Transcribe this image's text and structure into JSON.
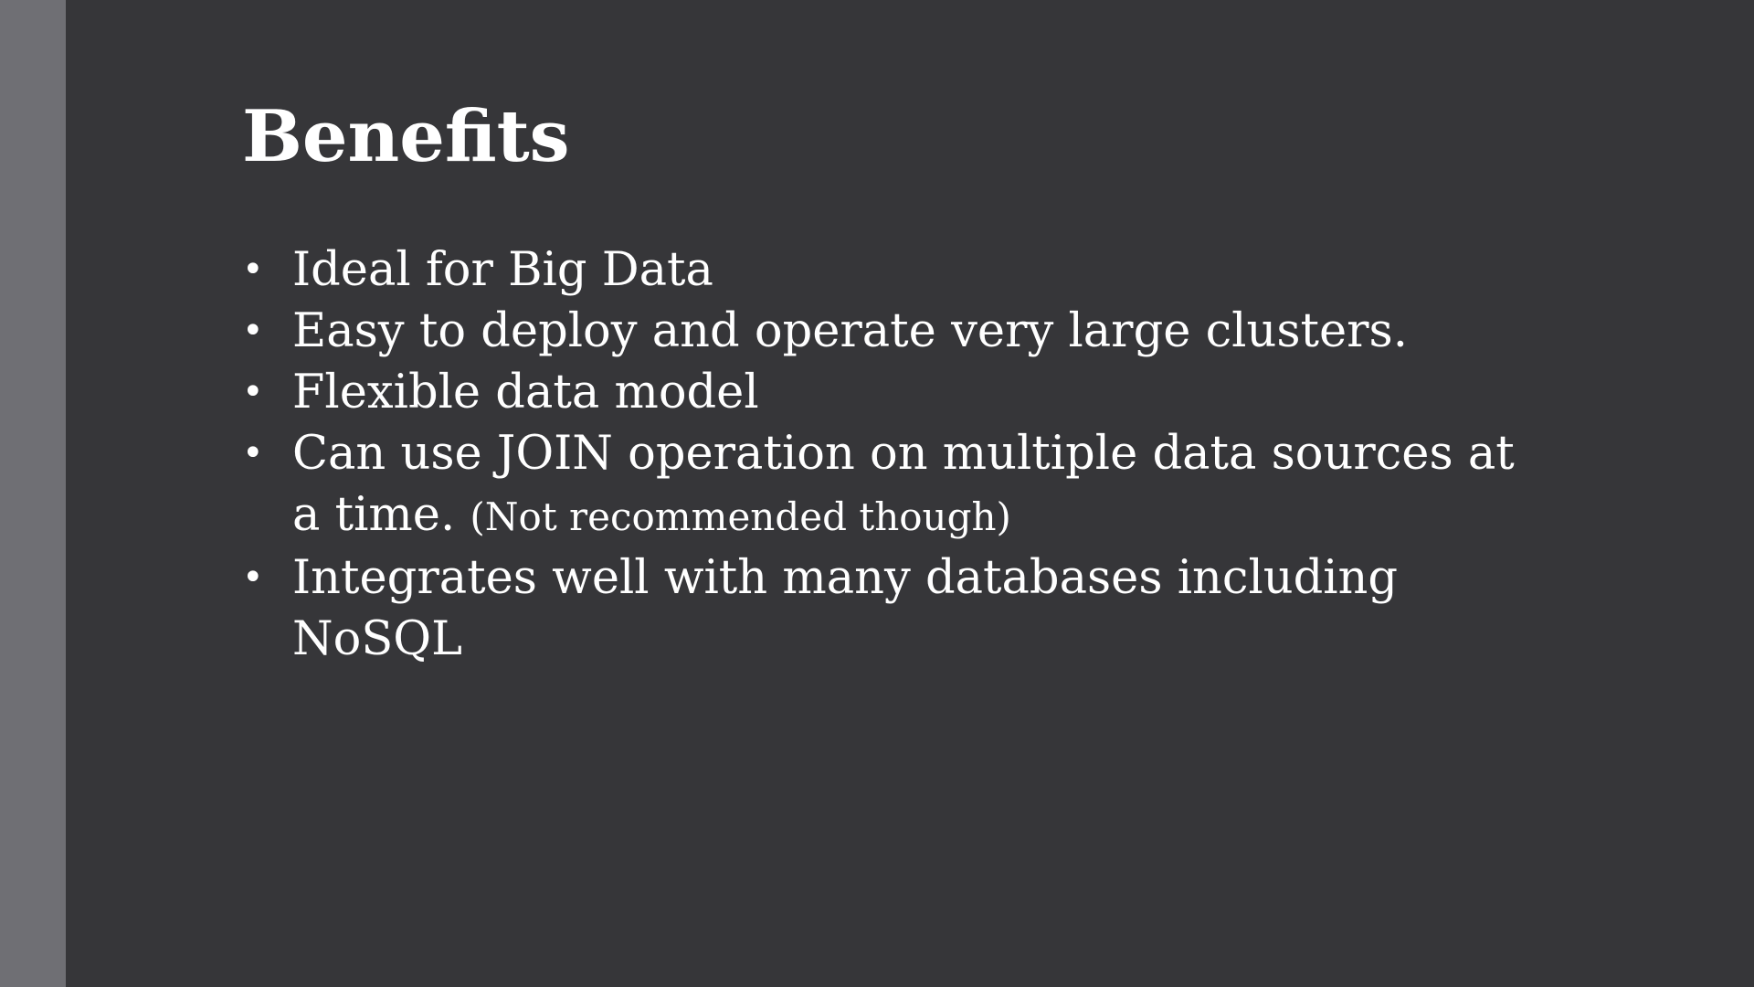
{
  "slide": {
    "title": "Benefits",
    "bullets": [
      {
        "text": "Ideal for Big Data"
      },
      {
        "text": "Easy to deploy and operate very large clusters."
      },
      {
        "text": "Flexible data model"
      },
      {
        "text": "Can use JOIN operation on multiple data sources at a time.",
        "note": "(Not recommended though)"
      },
      {
        "text": "Integrates well with many databases including NoSQL"
      }
    ],
    "bullet_symbol": "•"
  },
  "colors": {
    "background": "#363639",
    "side_stripe": "#6f6f74",
    "text": "#ffffff"
  }
}
